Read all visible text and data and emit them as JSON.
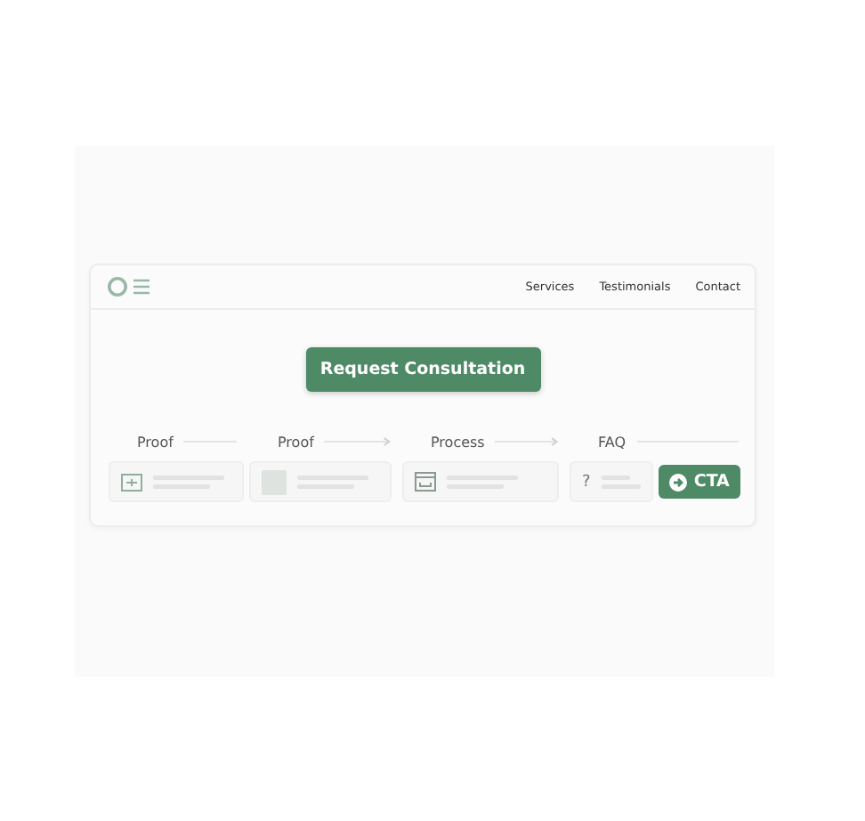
{
  "nav": {
    "links": [
      "Services",
      "Testimonials",
      "Contact"
    ]
  },
  "hero": {
    "button": "Request Consultation"
  },
  "steps": [
    {
      "label": "Proof",
      "arrow": false,
      "kind": "frame"
    },
    {
      "label": "Proof",
      "arrow": true,
      "kind": "image"
    },
    {
      "label": "Process",
      "arrow": true,
      "kind": "tray"
    },
    {
      "label": "FAQ",
      "arrow": false,
      "kind": "question",
      "mark": "?"
    }
  ],
  "cta": {
    "label": "CTA"
  }
}
